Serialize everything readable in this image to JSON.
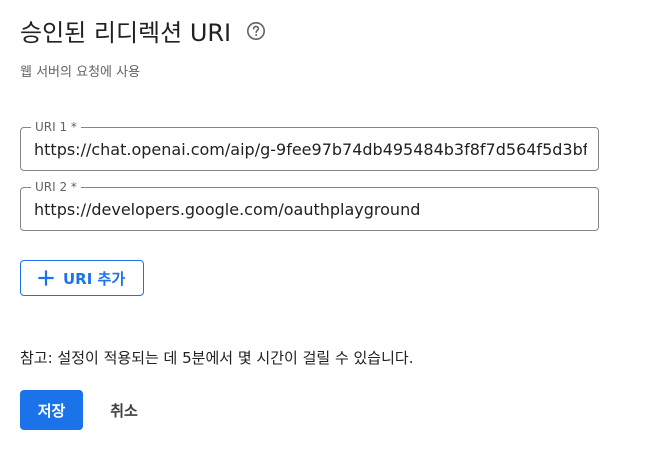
{
  "section": {
    "title": "승인된 리디렉션 URI",
    "help_icon": "help-circle-icon",
    "subtitle": "웹 서버의 요청에 사용"
  },
  "uris": [
    {
      "label": "URI 1 *",
      "value": "https://chat.openai.com/aip/g-9fee97b74db495484b3f8f7d564f5d3bf"
    },
    {
      "label": "URI 2 *",
      "value": "https://developers.google.com/oauthplayground"
    }
  ],
  "add_button": {
    "icon": "plus-icon",
    "label": "URI 추가"
  },
  "note": "참고: 설정이 적용되는 데 5분에서 몇 시간이 걸릴 수 있습니다.",
  "actions": {
    "save_label": "저장",
    "cancel_label": "취소"
  },
  "colors": {
    "primary": "#1a73e8",
    "text": "#202124",
    "secondary_text": "#5f6368",
    "border": "#80868b"
  }
}
